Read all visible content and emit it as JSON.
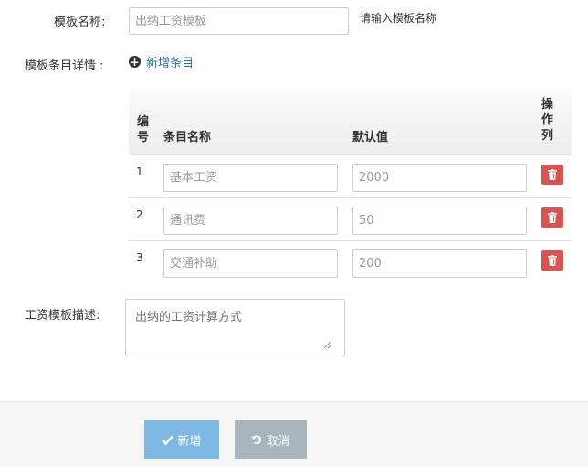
{
  "form": {
    "template_name_label": "模板名称:",
    "template_name_placeholder": "出纳工资模板",
    "template_name_hint": "请输入模板名称",
    "items_label": "模板条目详情 :",
    "add_item_label": "新增条目",
    "description_label": "工资模板描述:",
    "description_placeholder": "出纳的工资计算方式"
  },
  "table": {
    "headers": {
      "number": [
        "编",
        "号"
      ],
      "name": "条目名称",
      "default_value": "默认值",
      "action": [
        "操",
        "作",
        "列"
      ]
    },
    "rows": [
      {
        "no": "1",
        "name": "基本工资",
        "value": "2000"
      },
      {
        "no": "2",
        "name": "通讯费",
        "value": "50"
      },
      {
        "no": "3",
        "name": "交通补助",
        "value": "200"
      }
    ]
  },
  "footer": {
    "submit_label": "新增",
    "cancel_label": "取消"
  },
  "colors": {
    "primary_button": "#7db8e3",
    "cancel_button": "#a7b5bd",
    "delete_button": "#d9534f",
    "link": "#2d6ca2"
  },
  "icons": {
    "add": "plus-circle-icon",
    "delete": "trash-icon",
    "submit": "check-icon",
    "cancel": "undo-icon",
    "resize": "resize-handle-icon"
  }
}
